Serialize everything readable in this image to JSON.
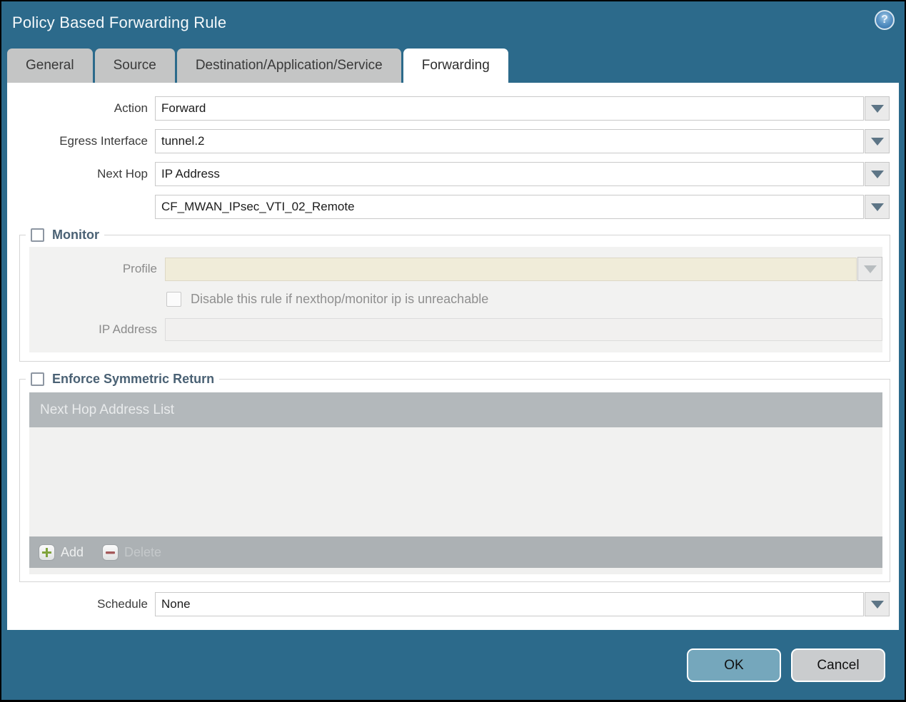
{
  "window": {
    "title": "Policy Based Forwarding Rule",
    "help_glyph": "?"
  },
  "tabs": [
    {
      "label": "General",
      "active": false
    },
    {
      "label": "Source",
      "active": false
    },
    {
      "label": "Destination/Application/Service",
      "active": false
    },
    {
      "label": "Forwarding",
      "active": true
    }
  ],
  "form": {
    "action": {
      "label": "Action",
      "value": "Forward"
    },
    "egress_interface": {
      "label": "Egress Interface",
      "value": "tunnel.2"
    },
    "next_hop": {
      "label": "Next Hop",
      "value": "IP Address"
    },
    "next_hop_address": {
      "value": "CF_MWAN_IPsec_VTI_02_Remote"
    },
    "schedule": {
      "label": "Schedule",
      "value": "None"
    }
  },
  "monitor": {
    "legend": "Monitor",
    "checked": false,
    "profile": {
      "label": "Profile",
      "value": ""
    },
    "disable_rule": {
      "label": "Disable this rule if nexthop/monitor ip is unreachable",
      "checked": false
    },
    "ip_address": {
      "label": "IP Address",
      "value": ""
    }
  },
  "symmetric_return": {
    "legend": "Enforce Symmetric Return",
    "checked": false,
    "table": {
      "header": "Next Hop Address List",
      "rows": []
    },
    "add_label": "Add",
    "delete_label": "Delete"
  },
  "footer": {
    "ok_label": "OK",
    "cancel_label": "Cancel"
  },
  "colors": {
    "chrome_teal": "#2c6a8b",
    "active_tab": "#ffffff",
    "inactive_tab": "#c4c5c5",
    "legend_text": "#4a6174",
    "disabled_field_beige": "#f0ecd9",
    "table_header_gray": "#b3b8bb",
    "ok_button": "#75a7bc",
    "cancel_button": "#caccce",
    "add_icon_green": "#7fa33c",
    "delete_icon_red": "#a4595a"
  }
}
